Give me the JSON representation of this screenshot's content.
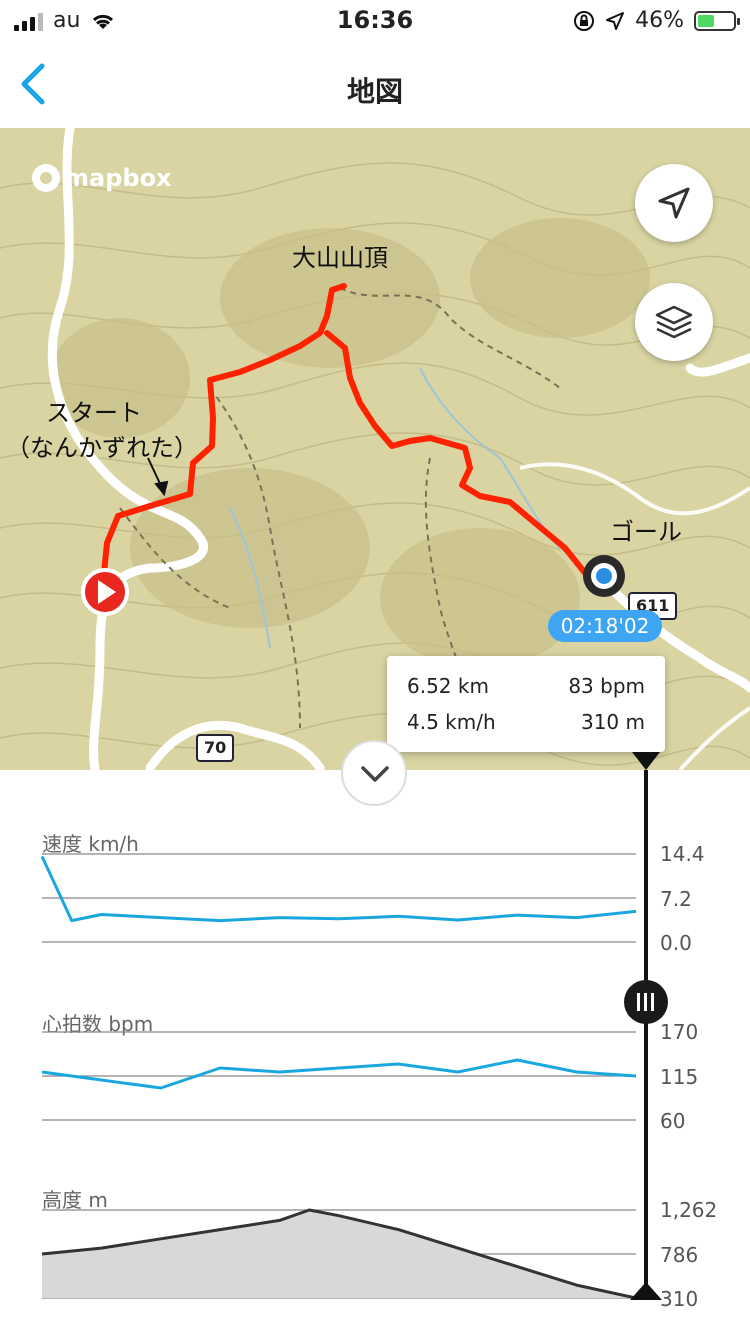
{
  "status_bar": {
    "carrier": "au",
    "time": "16:36",
    "battery": "46%"
  },
  "nav": {
    "title": "地図"
  },
  "map": {
    "attribution": "mapbox",
    "labels": {
      "summit": "大山山頂",
      "start_line1": "スタート",
      "start_line2": "（なんかずれた）",
      "goal": "ゴール"
    },
    "roads": [
      "611",
      "70"
    ],
    "elapsed_time": "02:18'02"
  },
  "info": {
    "distance": "6.52 km",
    "heart_rate": "83 bpm",
    "speed": "4.5 km/h",
    "altitude": "310  m"
  },
  "charts": {
    "speed": {
      "title": "速度 km/h",
      "ticks": [
        "14.4",
        "7.2",
        "0.0"
      ]
    },
    "heart_rate": {
      "title": "心拍数 bpm",
      "ticks": [
        "170",
        "115",
        "60"
      ]
    },
    "altitude": {
      "title": "高度 m",
      "ticks": [
        "1,262",
        "786",
        "310"
      ]
    }
  },
  "chart_data": [
    {
      "type": "line",
      "title": "速度 km/h",
      "ylim": [
        0,
        14.4
      ],
      "x": [
        0,
        0.05,
        0.1,
        0.2,
        0.3,
        0.4,
        0.5,
        0.6,
        0.7,
        0.8,
        0.9,
        1.0
      ],
      "values": [
        14.0,
        3.5,
        4.5,
        4.0,
        3.5,
        4.0,
        3.8,
        4.2,
        3.6,
        4.4,
        4.0,
        5.0
      ]
    },
    {
      "type": "line",
      "title": "心拍数 bpm",
      "ylim": [
        60,
        170
      ],
      "x": [
        0,
        0.1,
        0.2,
        0.3,
        0.4,
        0.5,
        0.6,
        0.7,
        0.8,
        0.9,
        1.0
      ],
      "values": [
        120,
        110,
        100,
        125,
        120,
        125,
        130,
        120,
        135,
        120,
        115
      ]
    },
    {
      "type": "area",
      "title": "高度 m",
      "ylim": [
        310,
        1262
      ],
      "x": [
        0,
        0.1,
        0.2,
        0.3,
        0.4,
        0.45,
        0.5,
        0.6,
        0.7,
        0.8,
        0.9,
        1.0
      ],
      "values": [
        786,
        850,
        950,
        1050,
        1150,
        1262,
        1200,
        1050,
        850,
        650,
        450,
        310
      ]
    }
  ],
  "colors": {
    "route": "#ff2200",
    "accent": "#3ea5f5",
    "line": "#1aa7e0",
    "map_bg": "#d9d4a2"
  }
}
